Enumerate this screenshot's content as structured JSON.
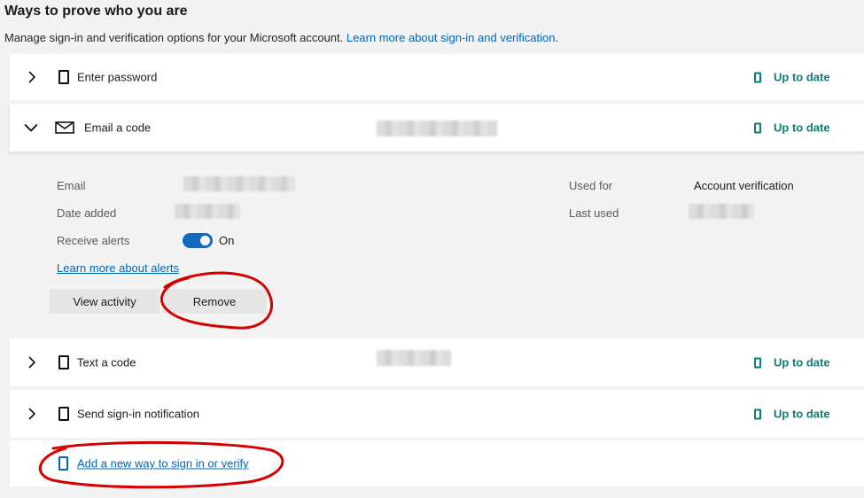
{
  "header": {
    "title": "Ways to prove who you are",
    "subtitle": "Manage sign-in and verification options for your Microsoft account.",
    "subtitle_link": "Learn more about sign-in and verification."
  },
  "methods": [
    {
      "label": "Enter password",
      "status": "Up to date",
      "icon": "phone-icon",
      "expanded": false
    },
    {
      "label": "Email a code",
      "status": "Up to date",
      "icon": "envelope-icon",
      "expanded": true
    },
    {
      "label": "Text a code",
      "status": "Up to date",
      "icon": "phone-icon",
      "expanded": false
    },
    {
      "label": "Send sign-in notification",
      "status": "Up to date",
      "icon": "phone-icon",
      "expanded": false
    }
  ],
  "details": {
    "email_label": "Email",
    "date_added_label": "Date added",
    "receive_alerts_label": "Receive alerts",
    "receive_alerts_state": "On",
    "used_for_label": "Used for",
    "used_for_value": "Account verification",
    "last_used_label": "Last used",
    "learn_more_alerts": "Learn more about alerts",
    "view_activity_label": "View activity",
    "remove_label": "Remove"
  },
  "add_method": {
    "label": "Add a new way to sign in or verify"
  },
  "colors": {
    "accent": "#0067b8",
    "status": "#107c74",
    "annotation": "#d40000"
  }
}
